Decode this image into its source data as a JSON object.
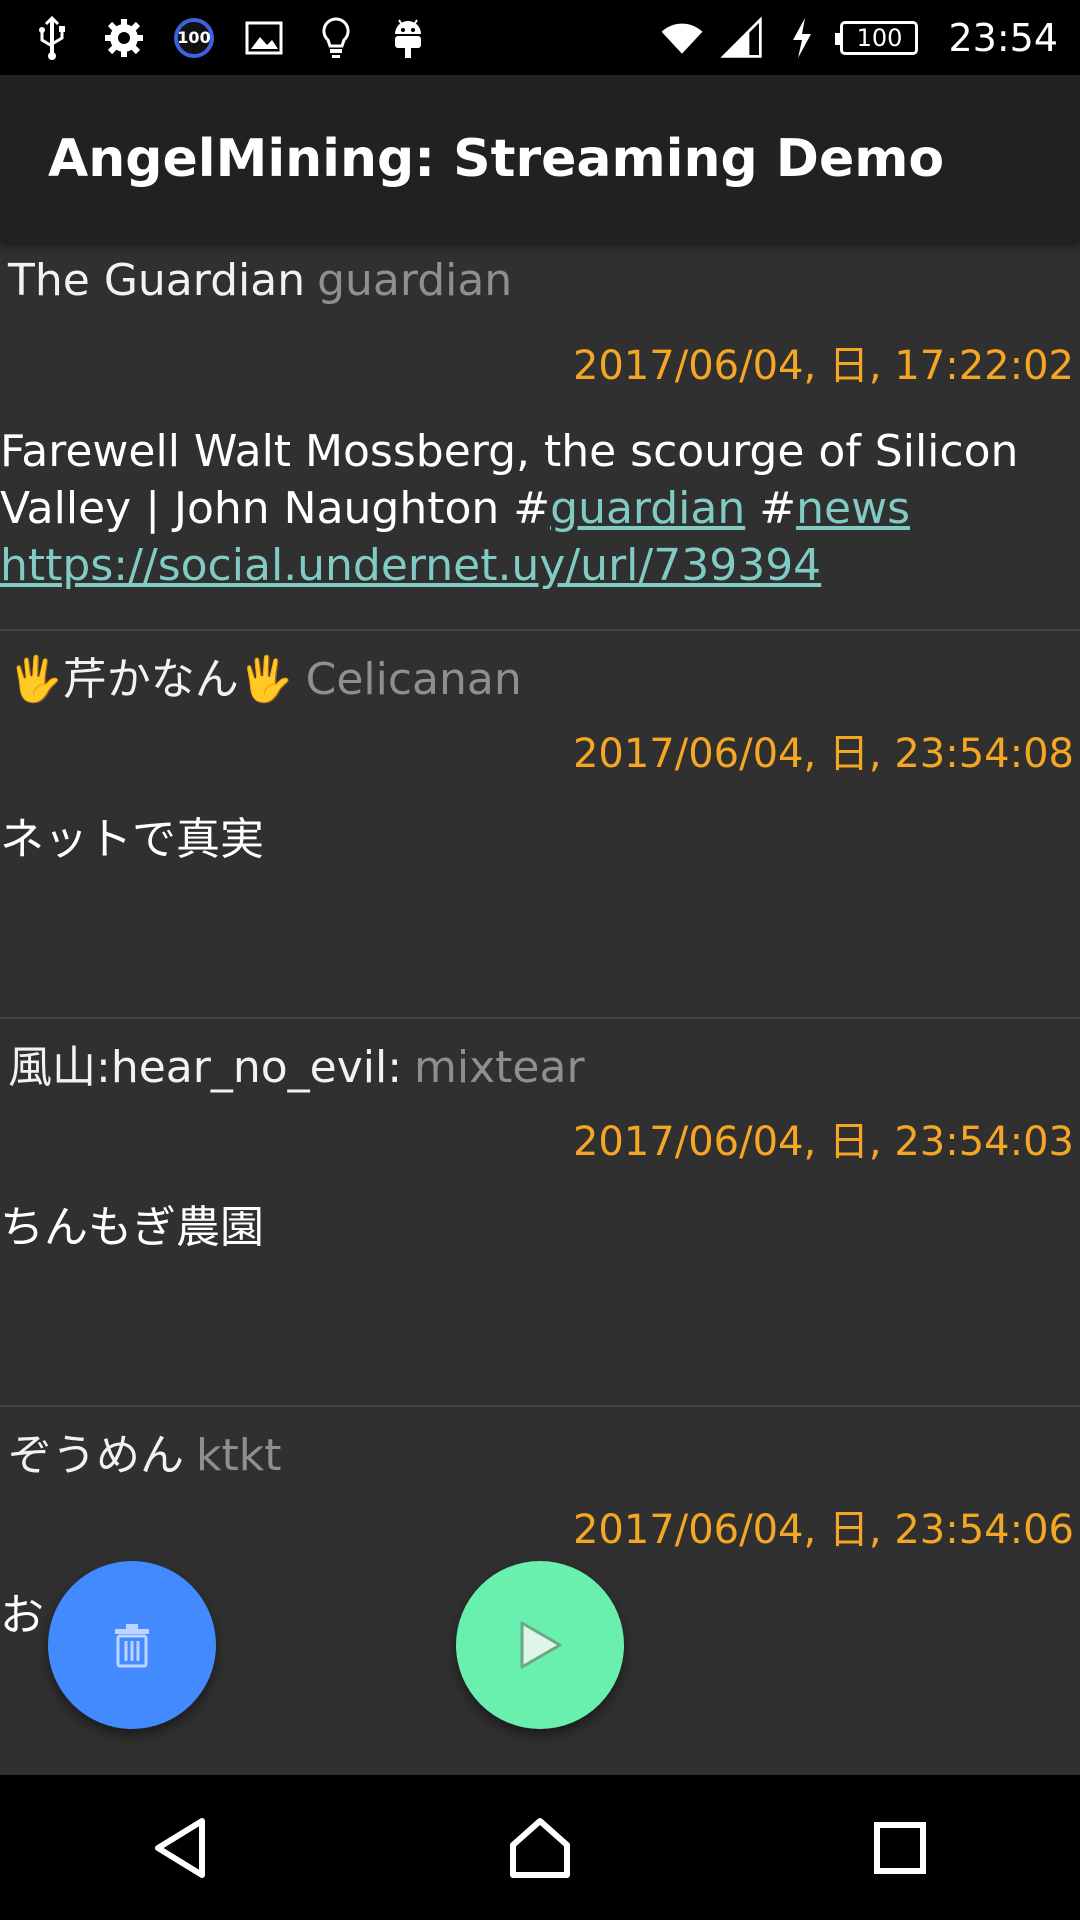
{
  "status_bar": {
    "left_icons": [
      "usb-icon",
      "gear-icon",
      "data-usage-badge",
      "image-icon",
      "lightbulb-icon",
      "android-icon"
    ],
    "badge_value": "100",
    "battery_level": "100",
    "time": "23:54"
  },
  "app_bar": {
    "title": "AngelMining: Streaming Demo"
  },
  "feed": [
    {
      "name": "The Guardian",
      "handle": "guardian",
      "date": "2017/06/04, 日, 17:22:02",
      "text_before": "Farewell Walt Mossberg, the scourge of Silicon Valley | John Naughton #",
      "tag1": "guardian",
      "text_mid": " #",
      "tag2": "news",
      "url": "https://social.undernet.uy/url/739394"
    },
    {
      "name_hand_left": "🖐",
      "name": "芹かなん",
      "name_hand_right": "🖐",
      "handle": "Celicanan",
      "date": "2017/06/04, 日, 23:54:08",
      "text": "ネットで真実"
    },
    {
      "name": "風山:hear_no_evil:",
      "handle": "mixtear",
      "date": "2017/06/04, 日, 23:54:03",
      "text": "ちんもぎ農園"
    },
    {
      "name": "ぞうめん",
      "handle": "ktkt",
      "date": "2017/06/04, 日, 23:54:06",
      "text": "お"
    }
  ],
  "colors": {
    "background": "#303030",
    "app_bar": "#212121",
    "date": "#f5a623",
    "handle": "#8f8f8f",
    "link": "#80cbc4",
    "fab_delete": "#448aff",
    "fab_play": "#69f0ae"
  },
  "fabs": {
    "delete_icon": "trash-icon",
    "play_icon": "play-icon"
  },
  "nav": [
    "back-icon",
    "home-icon",
    "recents-icon"
  ]
}
